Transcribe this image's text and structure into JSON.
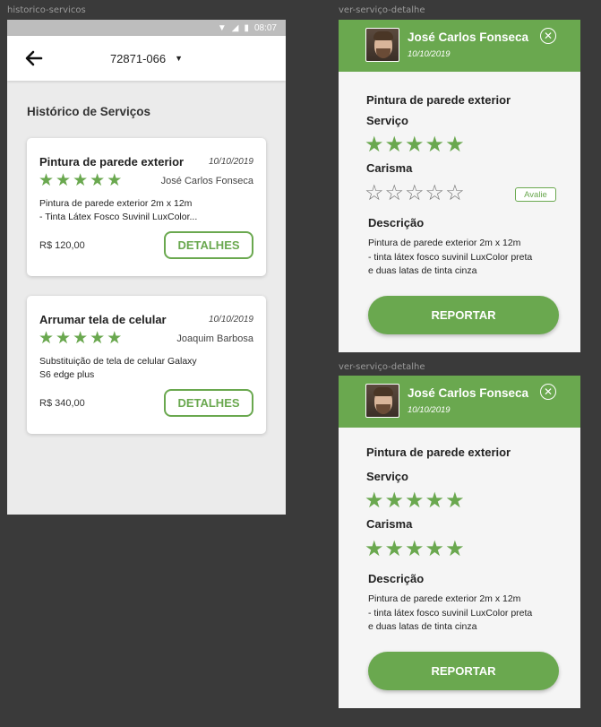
{
  "frames": {
    "left_label": "historico-servicos",
    "right_top_label": "ver-serviço-detalhe",
    "right_bottom_label": "ver-serviço-detalhe"
  },
  "statusbar": {
    "time": "08:07",
    "icons": [
      "wifi-icon",
      "signal-icon",
      "battery-icon"
    ]
  },
  "appbar": {
    "cep": "72871-066",
    "back_icon": "arrow-left-icon",
    "dropdown_icon": "caret-down-icon"
  },
  "page_title": "Histórico de Serviços",
  "colors": {
    "accent": "#6aa84f",
    "background": "#ebebeb",
    "star_empty": "#777777"
  },
  "cards": [
    {
      "title": "Pintura de parede exterior",
      "date": "10/10/2019",
      "rating": 5,
      "person": "José Carlos Fonseca",
      "description": "Pintura de parede exterior 2m x 12m\n- Tinta Látex Fosco Suvinil LuxColor...",
      "price": "R$ 120,00",
      "button": "DETALHES"
    },
    {
      "title": "Arrumar tela de celular",
      "date": "10/10/2019",
      "rating": 5,
      "person": "Joaquim Barbosa",
      "description": "Substituição de tela de celular Galaxy\nS6 edge plus",
      "price": "R$ 340,00",
      "button": "DETALHES"
    }
  ],
  "details": [
    {
      "name": "José Carlos Fonseca",
      "date": "10/10/2019",
      "service_title": "Pintura de parede exterior",
      "servico_label": "Serviço",
      "servico_rating": 5,
      "carisma_label": "Carisma",
      "carisma_rating": 0,
      "avalie_label": "Avalie",
      "descricao_label": "Descrição",
      "descricao": "Pintura de parede exterior 2m x 12m\n- tinta látex fosco suvinil LuxColor preta\ne duas latas de tinta cinza",
      "report_label": "REPORTAR"
    },
    {
      "name": "José Carlos Fonseca",
      "date": "10/10/2019",
      "service_title": "Pintura de parede exterior",
      "servico_label": "Serviço",
      "servico_rating": 5,
      "carisma_label": "Carisma",
      "carisma_rating": 5,
      "descricao_label": "Descrição",
      "descricao": "Pintura de parede exterior 2m x 12m\n- tinta látex fosco suvinil LuxColor preta\ne duas latas de tinta cinza",
      "report_label": "REPORTAR"
    }
  ]
}
